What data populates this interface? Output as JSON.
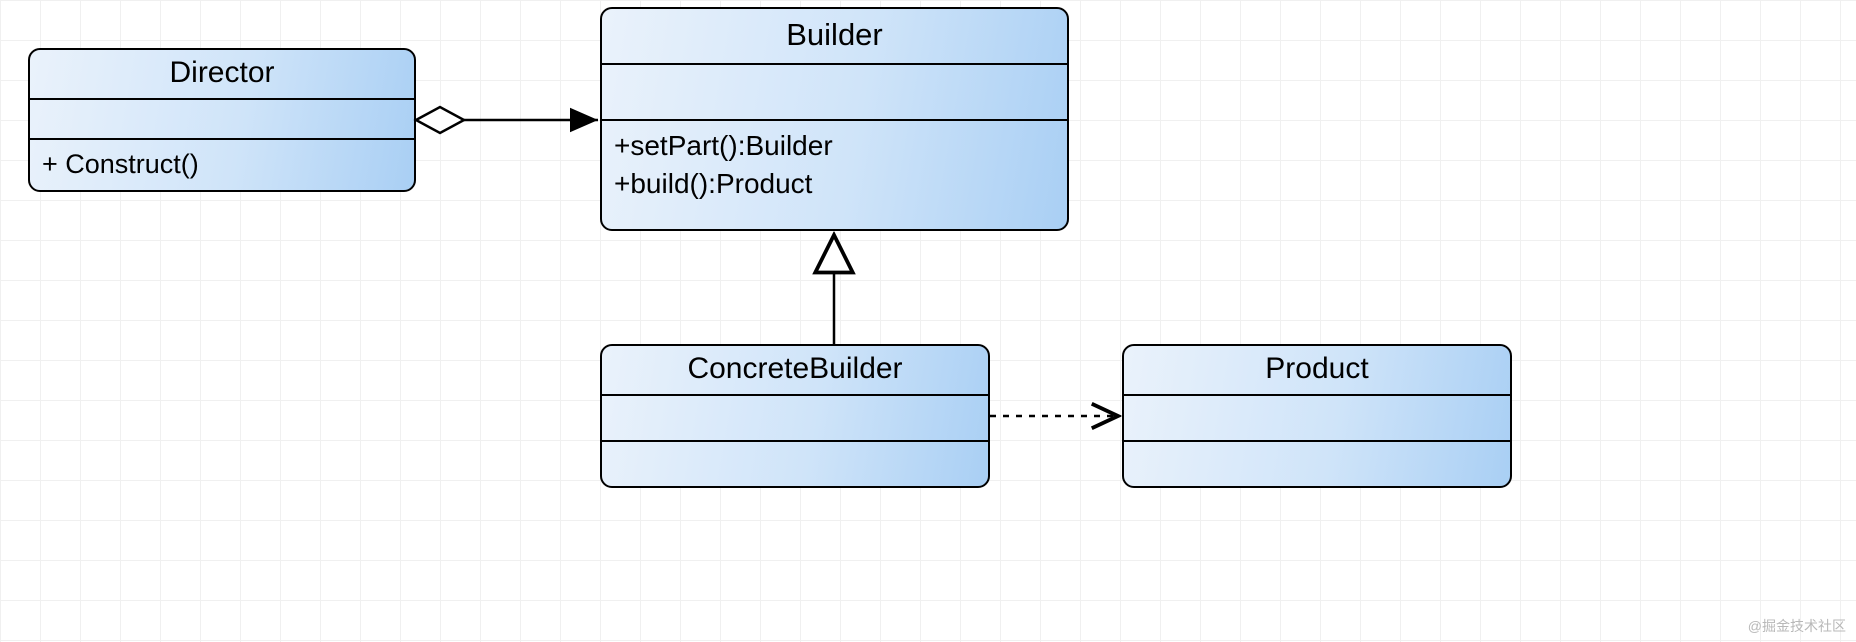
{
  "diagram": {
    "watermark": "@掘金技术社区",
    "classes": {
      "director": {
        "name": "Director",
        "operations": [
          "+ Construct()"
        ]
      },
      "builder": {
        "name": "Builder",
        "operations": [
          "+setPart():Builder",
          "+build():Product"
        ]
      },
      "concreteBuilder": {
        "name": "ConcreteBuilder",
        "operations": []
      },
      "product": {
        "name": "Product",
        "operations": []
      }
    },
    "relationships": [
      {
        "from": "Director",
        "to": "Builder",
        "type": "aggregation"
      },
      {
        "from": "ConcreteBuilder",
        "to": "Builder",
        "type": "generalization"
      },
      {
        "from": "ConcreteBuilder",
        "to": "Product",
        "type": "dependency"
      }
    ]
  }
}
